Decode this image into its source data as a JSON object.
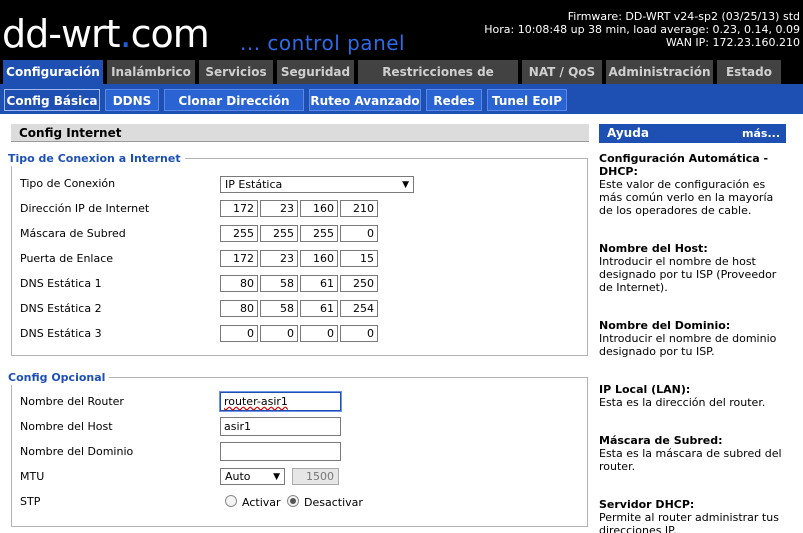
{
  "header": {
    "logo_main": "dd-wrt",
    "logo_dot": ".",
    "logo_tld": "com",
    "tagline": "... control panel",
    "firmware": "Firmware: DD-WRT v24-sp2 (03/25/13) std",
    "time": "Hora: 10:08:48 up 38 min, load average: 0.23, 0.14, 0.09",
    "wan_ip": "WAN IP: 172.23.160.210"
  },
  "main_tabs": [
    {
      "label": "Configuración"
    },
    {
      "label": "Inalámbrico"
    },
    {
      "label": "Servicios"
    },
    {
      "label": "Seguridad"
    },
    {
      "label": "Restricciones de Acceso"
    },
    {
      "label": "NAT / QoS"
    },
    {
      "label": "Administración"
    },
    {
      "label": "Estado"
    }
  ],
  "sub_tabs": [
    {
      "label": "Config Básica"
    },
    {
      "label": "DDNS"
    },
    {
      "label": "Clonar Dirección MAC"
    },
    {
      "label": "Ruteo Avanzado"
    },
    {
      "label": "Redes"
    },
    {
      "label": "Tunel EoIP"
    }
  ],
  "section_title": "Config Internet",
  "conexion": {
    "legend": "Tipo de Conexion a Internet",
    "tipo_label": "Tipo de Conexión",
    "tipo_value": "IP Estática",
    "rows": [
      {
        "label": "Dirección IP de Internet",
        "octets": [
          "172",
          "23",
          "160",
          "210"
        ]
      },
      {
        "label": "Máscara de Subred",
        "octets": [
          "255",
          "255",
          "255",
          "0"
        ]
      },
      {
        "label": "Puerta de Enlace",
        "octets": [
          "172",
          "23",
          "160",
          "15"
        ]
      },
      {
        "label": "DNS Estática 1",
        "octets": [
          "80",
          "58",
          "61",
          "250"
        ]
      },
      {
        "label": "DNS Estática 2",
        "octets": [
          "80",
          "58",
          "61",
          "254"
        ]
      },
      {
        "label": "DNS Estática 3",
        "octets": [
          "0",
          "0",
          "0",
          "0"
        ]
      }
    ]
  },
  "opcional": {
    "legend": "Config Opcional",
    "router_label": "Nombre del Router",
    "router_value": "router-asir1",
    "host_label": "Nombre del Host",
    "host_value": "asir1",
    "domain_label": "Nombre del Dominio",
    "domain_value": "",
    "mtu_label": "MTU",
    "mtu_mode": "Auto",
    "mtu_value": "1500",
    "stp_label": "STP",
    "stp_on": "Activar",
    "stp_off": "Desactivar"
  },
  "help": {
    "title": "Ayuda",
    "more": "más...",
    "items": [
      {
        "title": "Configuración Automática - DHCP:",
        "text": "Este valor de configuración es más común verlo en la mayoría de los operadores de cable."
      },
      {
        "title": "Nombre del Host:",
        "text": "Introducir el nombre de host designado por tu ISP (Proveedor de Internet)."
      },
      {
        "title": "Nombre del Dominio:",
        "text": "Introducir el nombre de dominio designado por tu ISP."
      },
      {
        "title": "IP Local (LAN):",
        "text": "Esta es la dirección del router."
      },
      {
        "title": "Máscara de Subred:",
        "text": "Esta es la máscara de subred del router."
      },
      {
        "title": "Servidor DHCP:",
        "text": "Permite al router administrar tus direcciones IP."
      }
    ]
  }
}
